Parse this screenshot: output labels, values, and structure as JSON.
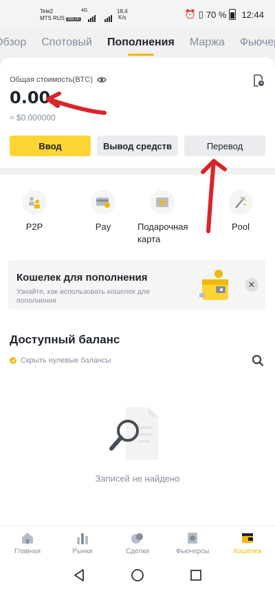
{
  "status_bar": {
    "carrier1": "Tele2",
    "carrier2": "MTS RUS",
    "volte": "VoLTE",
    "net": "4G",
    "speed_value": "18,4",
    "speed_unit": "K/s",
    "battery": "70 %",
    "time": "12:44"
  },
  "tabs": [
    "Обзор",
    "Спотовый",
    "Пополнения",
    "Маржа",
    "Фьючерс"
  ],
  "wallet": {
    "total_label": "Общая стоимость(BTC)",
    "total_value": "0.00",
    "fiat_value": "≈ $0.000000",
    "deposit_label": "Ввод",
    "withdraw_label": "Вывод средств",
    "transfer_label": "Перевод"
  },
  "quick_actions": [
    {
      "label": "P2P",
      "icon": "p2p-icon"
    },
    {
      "label": "Pay",
      "icon": "pay-icon"
    },
    {
      "label": "Подарочная карта",
      "icon": "gift-card-icon"
    },
    {
      "label": "Pool",
      "icon": "pool-icon"
    }
  ],
  "banner": {
    "title": "Кошелек для пополнения",
    "description": "Узнайте, как использовать кошелек для пополнения"
  },
  "balance": {
    "title": "Доступный баланс",
    "hide_zero_label": "Скрыть нулевые балансы",
    "empty_text": "Записей не найдено"
  },
  "bottom_nav": [
    {
      "label": "Главная",
      "icon": "home-icon",
      "active": false
    },
    {
      "label": "Рынки",
      "icon": "markets-icon",
      "active": false
    },
    {
      "label": "Сделки",
      "icon": "trades-icon",
      "active": false
    },
    {
      "label": "Фьючерсы",
      "icon": "futures-icon",
      "active": false
    },
    {
      "label": "Кошелек",
      "icon": "wallet-icon",
      "active": true
    }
  ],
  "colors": {
    "accent": "#f0b90b",
    "primary_button": "#fcd535",
    "annotation_arrow": "#d9252a"
  }
}
